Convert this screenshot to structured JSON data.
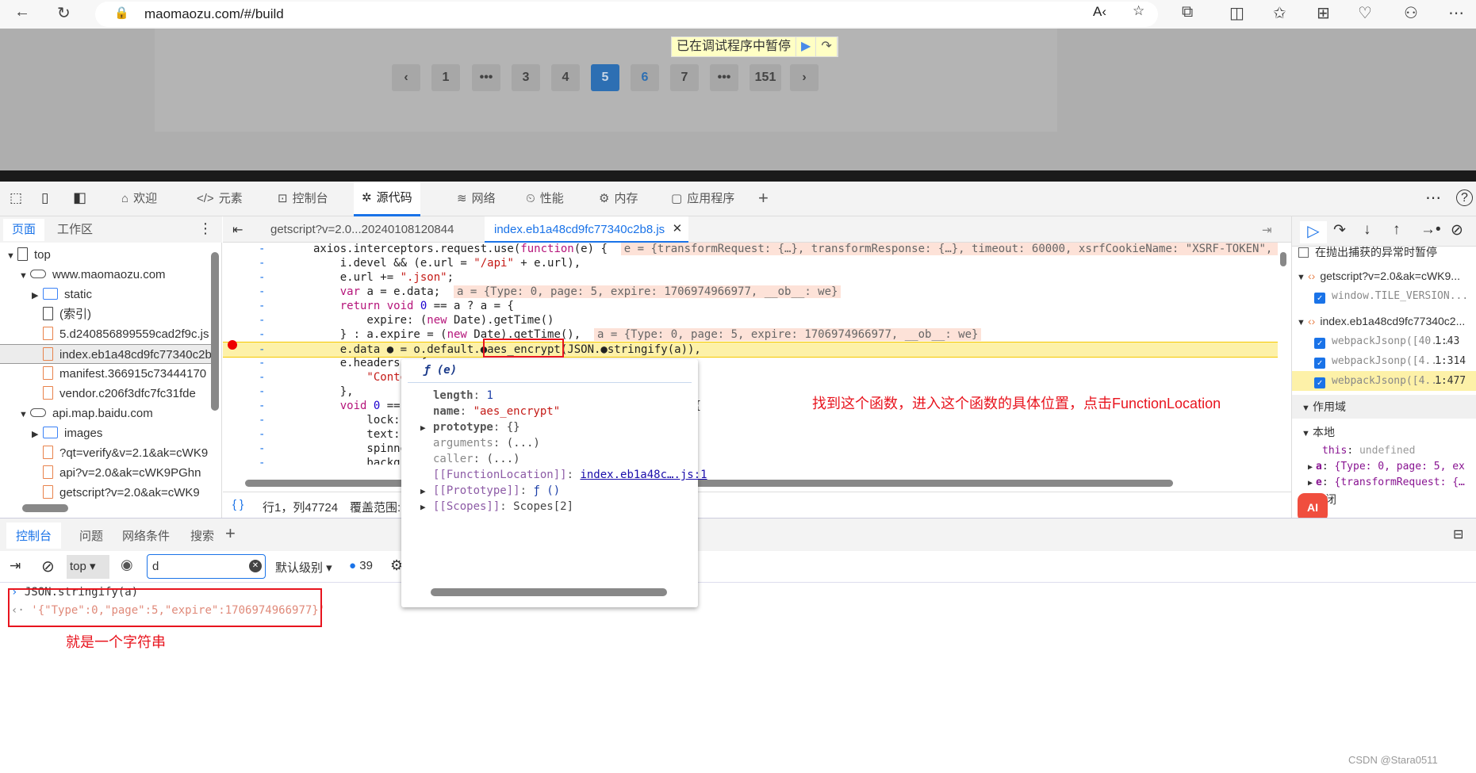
{
  "browser": {
    "url": "maomaozu.com/#/build",
    "icons": [
      "back-icon",
      "refresh-icon",
      "lock-icon",
      "read-aloud-icon",
      "favorite-icon",
      "extensions-icon",
      "split-screen-icon",
      "favorites-icon",
      "collections-icon",
      "browser-essentials-icon",
      "profile-icon",
      "more-icon"
    ]
  },
  "page": {
    "pagination": [
      "‹",
      "1",
      "•••",
      "3",
      "4",
      "5",
      "6",
      "7",
      "•••",
      "151",
      "›"
    ],
    "current": "5",
    "paused_text": "已在调试程序中暂停"
  },
  "devtools": {
    "tabs": [
      "欢迎",
      "元素",
      "控制台",
      "源代码",
      "网络",
      "性能",
      "内存",
      "应用程序"
    ],
    "active_tab": "源代码",
    "nav": {
      "tabs": [
        "页面",
        "工作区"
      ],
      "tree": [
        {
          "label": "top",
          "depth": 0,
          "kind": "frame",
          "arrow": "▼"
        },
        {
          "label": "www.maomaozu.com",
          "depth": 1,
          "kind": "cloud",
          "arrow": "▼"
        },
        {
          "label": "static",
          "depth": 2,
          "kind": "folder",
          "arrow": "▶"
        },
        {
          "label": "(索引)",
          "depth": 2,
          "kind": "plain",
          "arrow": ""
        },
        {
          "label": "5.d240856899559cad2f9c.js",
          "depth": 2,
          "kind": "file",
          "arrow": ""
        },
        {
          "label": "index.eb1a48cd9fc77340c2b8.js",
          "depth": 2,
          "kind": "file",
          "arrow": "",
          "selected": true
        },
        {
          "label": "manifest.366915c73444170",
          "depth": 2,
          "kind": "file",
          "arrow": ""
        },
        {
          "label": "vendor.c206f3dfc7fc31fde",
          "depth": 2,
          "kind": "file",
          "arrow": ""
        },
        {
          "label": "api.map.baidu.com",
          "depth": 1,
          "kind": "cloud",
          "arrow": "▼"
        },
        {
          "label": "images",
          "depth": 2,
          "kind": "folder",
          "arrow": "▶"
        },
        {
          "label": "?qt=verify&v=2.1&ak=cWK9",
          "depth": 2,
          "kind": "file",
          "arrow": ""
        },
        {
          "label": "api?v=2.0&ak=cWK9PGhn",
          "depth": 2,
          "kind": "file",
          "arrow": ""
        },
        {
          "label": "getscript?v=2.0&ak=cWK9",
          "depth": 2,
          "kind": "file",
          "arrow": ""
        }
      ]
    },
    "editor": {
      "tabs": [
        "getscript?v=2.0...20240108120844",
        "index.eb1a48cd9fc77340c2b8.js"
      ],
      "lines": [
        [
          {
            "t": "axios.interceptors.request.use(",
            "c": "id"
          },
          {
            "t": "function",
            "c": "kw"
          },
          {
            "t": "(e) {  ",
            "c": "id"
          },
          {
            "t": "e = {transformRequest: {…}, transformResponse: {…}, timeout: 60000, xsrfCookieName: \"XSRF-TOKEN\", ada",
            "c": "inl"
          }
        ],
        [
          {
            "t": "    i.devel && (e.url = ",
            "c": "id"
          },
          {
            "t": "\"/api\"",
            "c": "str"
          },
          {
            "t": " + e.url),",
            "c": "id"
          }
        ],
        [
          {
            "t": "    e.url += ",
            "c": "id"
          },
          {
            "t": "\".json\"",
            "c": "str"
          },
          {
            "t": ";",
            "c": "id"
          }
        ],
        [
          {
            "t": "    var",
            "c": "kw"
          },
          {
            "t": " a = e.data;  ",
            "c": "id"
          },
          {
            "t": "a = {Type: 0, page: 5, expire: 1706974966977, __ob__: we}",
            "c": "inl"
          }
        ],
        [
          {
            "t": "    return void ",
            "c": "kw"
          },
          {
            "t": "0",
            "c": "num"
          },
          {
            "t": " == a ? a = {",
            "c": "id"
          }
        ],
        [
          {
            "t": "        expire: (",
            "c": "id"
          },
          {
            "t": "new",
            "c": "kw"
          },
          {
            "t": " Date).getTime()",
            "c": "id"
          }
        ],
        [
          {
            "t": "    } : a.expire = (",
            "c": "id"
          },
          {
            "t": "new",
            "c": "kw"
          },
          {
            "t": " Date).getTime(),  ",
            "c": "id"
          },
          {
            "t": "a = {Type: 0, page: 5, expire: 1706974966977, __ob__: we}",
            "c": "inl"
          }
        ],
        [
          {
            "t": "    e.data ● = o.default.●aes_encrypt(JSON.●stringify(a)),",
            "c": "id"
          }
        ],
        [
          {
            "t": "    e.headers = {",
            "c": "id"
          }
        ],
        [
          {
            "t": "        \"Content-Type\"",
            "c": "str"
          }
        ],
        [
          {
            "t": "    },",
            "c": "id"
          }
        ],
        [
          {
            "t": "    void ",
            "c": "kw"
          },
          {
            "t": "0",
            "c": "num"
          },
          {
            "t": " == ...                                      e({",
            "c": "id"
          }
        ],
        [
          {
            "t": "        lock:",
            "c": "id"
          }
        ],
        [
          {
            "t": "        text:",
            "c": "id"
          }
        ],
        [
          {
            "t": "        spinner",
            "c": "id"
          }
        ],
        [
          {
            "t": "        background",
            "c": "id"
          }
        ],
        [
          {
            "t": "    }))",
            "c": "id"
          }
        ]
      ],
      "status": {
        "braces": "{ }",
        "position": "行1，列47724",
        "coverage": "覆盖范围: 不适用"
      }
    },
    "popup": {
      "header": "ƒ (e)",
      "rows": [
        {
          "k": "length",
          "v": "1",
          "vc": "num",
          "arrow": ""
        },
        {
          "k": "name",
          "v": "\"aes_encrypt\"",
          "vc": "str",
          "arrow": ""
        },
        {
          "k": "prototype",
          "v": "{}",
          "vc": "id",
          "arrow": "▶"
        },
        {
          "k": "arguments",
          "v": "(...)",
          "vc": "id",
          "arrow": ""
        },
        {
          "k": "caller",
          "v": "(...)",
          "vc": "id",
          "arrow": ""
        },
        {
          "k": "[[FunctionLocation]]",
          "v": "index.eb1a48c….js:1",
          "vc": "link",
          "arrow": ""
        },
        {
          "k": "[[Prototype]]",
          "v": "ƒ ()",
          "vc": "num",
          "arrow": "▶"
        },
        {
          "k": "[[Scopes]]",
          "v": "Scopes[2]",
          "vc": "id",
          "arrow": "▶"
        }
      ]
    },
    "debugger": {
      "pause_caught": "在抛出捕获的异常时暂停",
      "breakpoints": [
        {
          "file": "getscript?v=2.0&ak=cWK9...",
          "items": [
            {
              "label": "window.TILE_VERSION...",
              "loc": ""
            }
          ]
        },
        {
          "file": "index.eb1a48cd9fc77340c2...",
          "items": [
            {
              "label": "webpackJsonp([40...",
              "loc": "1:43"
            },
            {
              "label": "webpackJsonp([4...",
              "loc": "1:314"
            },
            {
              "label": "webpackJsonp([4...",
              "loc": "1:477"
            }
          ]
        }
      ],
      "scope_title": "作用域",
      "local": "本地",
      "scope": [
        {
          "k": "this",
          "v": "undefined"
        },
        {
          "k": "a",
          "v": "{Type: 0, page: 5, ex"
        },
        {
          "k": "e",
          "v": "{transformRequest: {…"
        }
      ],
      "closure": "闭"
    },
    "drawer": {
      "tabs": [
        "控制台",
        "问题",
        "网络条件",
        "搜索"
      ]
    },
    "console": {
      "context": "top",
      "filter": "d",
      "level": "默认级别",
      "msg_count": "39",
      "input": "JSON.stringify(a)",
      "output": "'{\"Type\":0,\"page\":5,\"expire\":1706974966977}'"
    }
  },
  "annotations": {
    "function_hint": "找到这个函数，进入这个函数的具体位置，点击FunctionLocation",
    "string_hint": "就是一个字符串"
  },
  "watermark": "CSDN @Stara0511",
  "colors": {
    "accent": "#1a73e8",
    "annotation": "#e8141e",
    "pause_line": "#fdf1a8"
  }
}
